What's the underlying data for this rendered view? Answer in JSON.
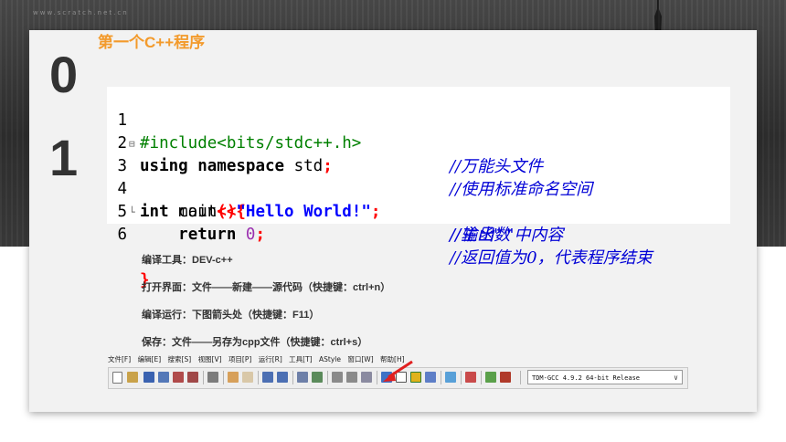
{
  "header": {
    "watermark": "www.scratch.net.cn"
  },
  "section": {
    "digit_top": "0",
    "digit_bottom": "1",
    "title": "第一个C++程序"
  },
  "code": {
    "lines": [
      {
        "num": "1",
        "pp": "#include<bits/stdc++.h>",
        "comment": "//万能头文件"
      },
      {
        "num": "2",
        "kw1": "using",
        "kw2": "namespace",
        "rest": " std",
        "semi": ";",
        "comment": "//使用标准命名空间"
      },
      {
        "num": "3",
        "kw": "int",
        "rest": " main",
        "brackets": "(){",
        "comment": "//主函数"
      },
      {
        "num": "4",
        "indent": "    cout",
        "op": "<<",
        "str": "\"Hello World!\"",
        "semi": ";",
        "comment": "//输出\" \"中内容"
      },
      {
        "num": "5",
        "kw": "return",
        "zero": "0",
        "semi": ";",
        "comment": "//返回值为0，代表程序结束"
      },
      {
        "num": "6",
        "brace": "}"
      }
    ]
  },
  "info": {
    "tool": "编译工具：DEV-c++",
    "open": "打开界面：文件——新建——源代码（快捷键：ctrl+n）",
    "compile": "编译运行：下图箭头处（快捷键：F11）",
    "save": "保存：文件——另存为cpp文件（快捷键：ctrl+s）"
  },
  "ide": {
    "menus": [
      "文件[F]",
      "编辑[E]",
      "搜索[S]",
      "视图[V]",
      "项目[P]",
      "运行[R]",
      "工具[T]",
      "AStyle",
      "窗口[W]",
      "帮助[H]"
    ],
    "compiler_select": "TDM-GCC 4.9.2 64-bit Release"
  },
  "colors": {
    "accent": "#f39a2b",
    "comment": "#0000d6",
    "keyword_red": "#ff0000"
  }
}
